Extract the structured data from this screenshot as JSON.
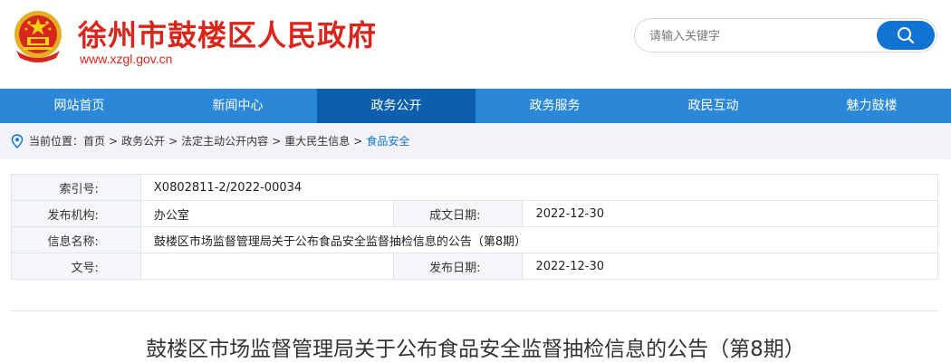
{
  "header": {
    "site_title": "徐州市鼓楼区人民政府",
    "site_url": "www.xzgl.gov.cn",
    "emblem_icon": "national-emblem-icon"
  },
  "search": {
    "placeholder": "请输入关键字",
    "button_icon": "search-icon"
  },
  "nav": {
    "items": [
      {
        "label": "网站首页"
      },
      {
        "label": "新闻中心"
      },
      {
        "label": "政务公开",
        "active": true
      },
      {
        "label": "政务服务"
      },
      {
        "label": "政民互动"
      },
      {
        "label": "魅力鼓楼"
      }
    ]
  },
  "breadcrumb": {
    "prefix": "当前位置：",
    "items": [
      "首页",
      "政务公开",
      "法定主动公开内容",
      "重大民生信息"
    ],
    "current": "食品安全",
    "separator": ">"
  },
  "info": {
    "index_label": "索引号:",
    "index_value": "X0802811-2/2022-00034",
    "publisher_label": "发布机构:",
    "publisher_value": "办公室",
    "created_label": "成文日期:",
    "created_value": "2022-12-30",
    "name_label": "信息名称:",
    "name_value": "鼓楼区市场监督管理局关于公布食品安全监督抽检信息的公告（第8期）",
    "docno_label": "文号:",
    "docno_value": "",
    "published_label": "发布日期:",
    "published_value": "2022-12-30"
  },
  "article": {
    "title": "鼓楼区市场监督管理局关于公布食品安全监督抽检信息的公告（第8期）"
  },
  "colors": {
    "brand_red": "#d9261c",
    "nav_blue": "#2b88d8",
    "nav_active": "#0b5fad",
    "accent_blue": "#1173d2"
  }
}
